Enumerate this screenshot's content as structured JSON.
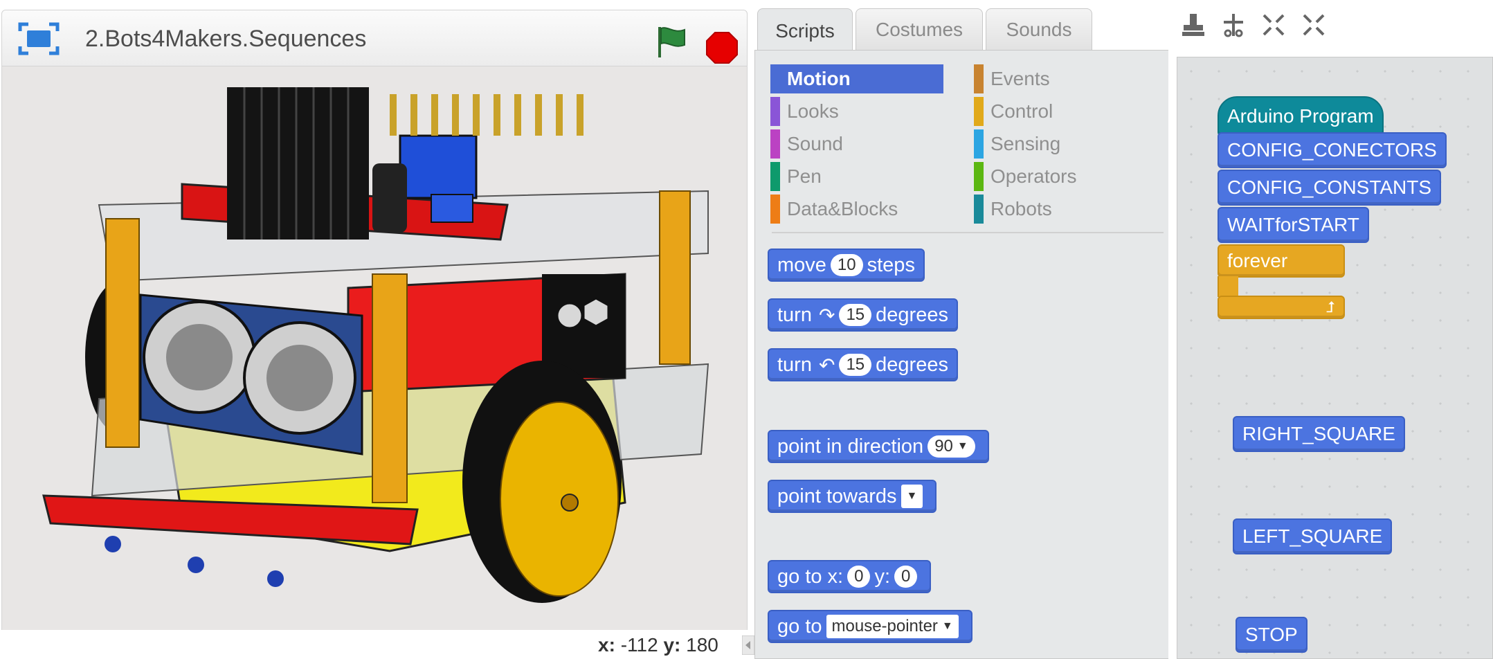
{
  "stage": {
    "project_title": "2.Bots4Makers.Sequences",
    "coords": {
      "x_label": "x:",
      "x_value": "-112",
      "y_label": "y:",
      "y_value": "180"
    }
  },
  "tabs": [
    {
      "label": "Scripts",
      "active": true
    },
    {
      "label": "Costumes",
      "active": false
    },
    {
      "label": "Sounds",
      "active": false
    }
  ],
  "toolbar_icons": [
    "duplicate-stamp-icon",
    "delete-scissors-icon",
    "grow-icon",
    "shrink-icon"
  ],
  "categories": [
    {
      "label": "Motion",
      "color": "#4a6cd4",
      "active": true
    },
    {
      "label": "Looks",
      "color": "#8a55d7",
      "active": false
    },
    {
      "label": "Sound",
      "color": "#bb42c3",
      "active": false
    },
    {
      "label": "Pen",
      "color": "#0e9a6c",
      "active": false
    },
    {
      "label": "Data&Blocks",
      "color": "#ee7d16",
      "active": false
    },
    {
      "label": "Events",
      "color": "#c88330",
      "active": false
    },
    {
      "label": "Control",
      "color": "#e1a91a",
      "active": false
    },
    {
      "label": "Sensing",
      "color": "#2ca5e2",
      "active": false
    },
    {
      "label": "Operators",
      "color": "#5cb712",
      "active": false
    },
    {
      "label": "Robots",
      "color": "#1a8a9a",
      "active": false
    }
  ],
  "palette_blocks": {
    "move": {
      "pre": "move",
      "value": "10",
      "post": "steps"
    },
    "turn_cw": {
      "pre": "turn",
      "value": "15",
      "post": "degrees"
    },
    "turn_ccw": {
      "pre": "turn",
      "value": "15",
      "post": "degrees"
    },
    "point_dir": {
      "pre": "point in direction",
      "value": "90"
    },
    "point_towards": {
      "pre": "point towards"
    },
    "goto_xy": {
      "pre": "go to x:",
      "x": "0",
      "mid": "y:",
      "y": "0"
    },
    "goto": {
      "pre": "go to",
      "value": "mouse-pointer"
    }
  },
  "script_blocks": {
    "hat": "Arduino Program",
    "config_connectors": "CONFIG_CONECTORS",
    "config_constants": "CONFIG_CONSTANTS",
    "wait_for_start": "WAITforSTART",
    "forever": "forever",
    "right_square": "RIGHT_SQUARE",
    "left_square": "LEFT_SQUARE",
    "stop": "STOP"
  },
  "colors": {
    "motion_block": "#4c74e0",
    "control_block": "#e6a722",
    "arduino_hat": "#0e8a9a",
    "stop_button": "#e60000",
    "green_flag": "#2d8a3e"
  }
}
